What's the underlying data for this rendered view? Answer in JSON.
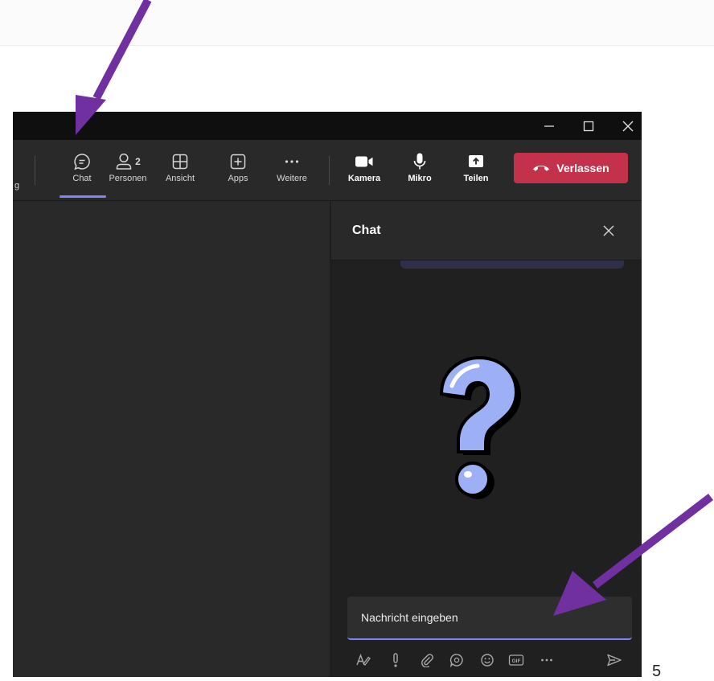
{
  "titlebar": {
    "minimize_icon": "minimize-icon",
    "maximize_icon": "maximize-icon",
    "close_icon": "close-icon"
  },
  "toolbar": {
    "truncated_label": "g",
    "items": [
      {
        "label": "Chat",
        "icon": "chat-icon",
        "active": true
      },
      {
        "label": "Personen",
        "icon": "people-icon",
        "badge": "2"
      },
      {
        "label": "Ansicht",
        "icon": "layout-icon"
      },
      {
        "label": "Apps",
        "icon": "apps-icon"
      },
      {
        "label": "Weitere",
        "icon": "more-icon"
      },
      {
        "label": "Kamera",
        "icon": "camera-icon"
      },
      {
        "label": "Mikro",
        "icon": "microphone-icon"
      },
      {
        "label": "Teilen",
        "icon": "share-icon"
      }
    ],
    "leave_label": "Verlassen",
    "leave_color": "#c4314b",
    "accent": "#7f85f5"
  },
  "chat": {
    "title": "Chat",
    "placeholder": "Nachricht eingeben",
    "format_icons": [
      "format-icon",
      "important-icon",
      "attach-icon",
      "loop-icon",
      "emoji-icon",
      "gif-icon",
      "more-icon",
      "send-icon"
    ]
  },
  "annotations": {
    "arrow_color": "#7030a0",
    "page_number": "5"
  }
}
